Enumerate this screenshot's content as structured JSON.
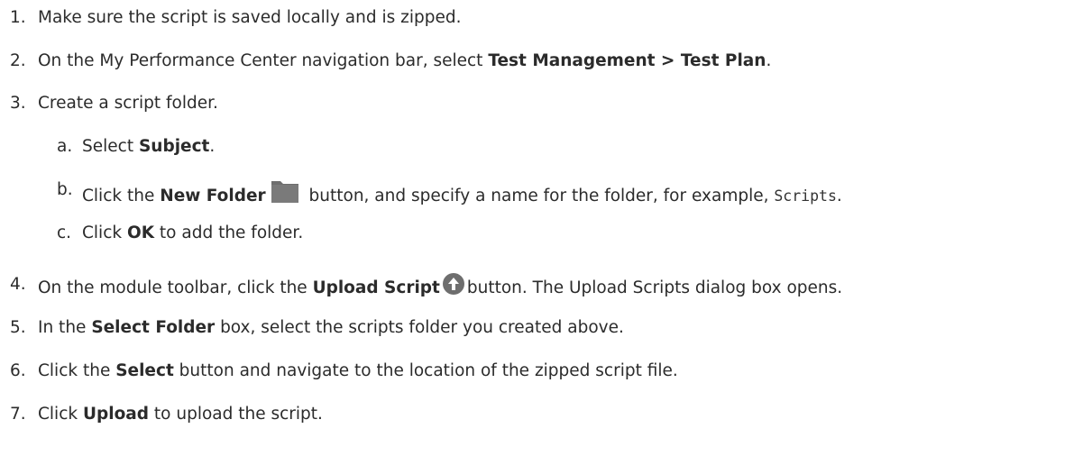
{
  "steps": [
    {
      "num": "1.",
      "parts": [
        "Make sure the script is saved locally and is zipped."
      ]
    },
    {
      "num": "2.",
      "parts": [
        "On the My Performance Center navigation bar, select ",
        "Test Management > Test Plan",
        "."
      ]
    },
    {
      "num": "3.",
      "parts": [
        "Create a script folder."
      ]
    },
    {
      "num": "4.",
      "parts": [
        "On the module toolbar, click the ",
        "Upload Script",
        "button. The Upload Scripts dialog box opens."
      ]
    },
    {
      "num": "5.",
      "parts": [
        "In the ",
        "Select Folder",
        " box, select the scripts folder you created above."
      ]
    },
    {
      "num": "6.",
      "parts": [
        "Click the ",
        "Select",
        " button and navigate to the location of the zipped script file."
      ]
    },
    {
      "num": "7.",
      "parts": [
        "Click ",
        "Upload",
        " to upload the script."
      ]
    }
  ],
  "substeps": [
    {
      "num": "a.",
      "parts": [
        "Select ",
        "Subject",
        "."
      ]
    },
    {
      "num": "b.",
      "parts": [
        "Click the ",
        "New Folder",
        " button, and specify a name for the folder, for example, ",
        "Scripts",
        "."
      ]
    },
    {
      "num": "c.",
      "parts": [
        "Click ",
        "OK",
        " to add the folder."
      ]
    }
  ],
  "icons": {
    "folder": "new-folder-icon",
    "upload": "upload-script-icon",
    "icon_color": "#6e6e6e"
  }
}
